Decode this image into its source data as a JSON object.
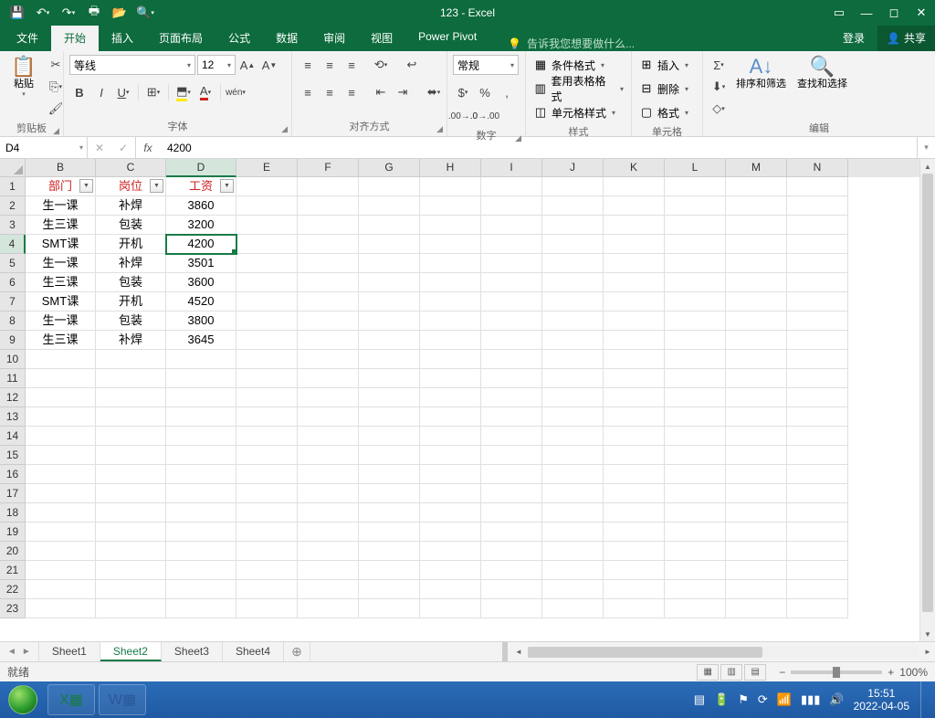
{
  "window_title": "123 - Excel",
  "qat": {
    "tips": [
      "save",
      "undo",
      "redo",
      "quick-print",
      "open",
      "print-preview"
    ]
  },
  "tabs": {
    "file": "文件",
    "list": [
      "开始",
      "插入",
      "页面布局",
      "公式",
      "数据",
      "审阅",
      "视图",
      "Power Pivot"
    ],
    "active": "开始",
    "tellme_placeholder": "告诉我您想要做什么...",
    "login": "登录",
    "share": "共享"
  },
  "ribbon": {
    "clipboard": {
      "paste": "粘贴",
      "group": "剪贴板"
    },
    "font": {
      "name": "等线",
      "size": "12",
      "group": "字体"
    },
    "align": {
      "group": "对齐方式"
    },
    "number": {
      "format": "常规",
      "group": "数字"
    },
    "styles": {
      "cond": "条件格式",
      "table": "套用表格格式",
      "cell": "单元格样式",
      "group": "样式"
    },
    "cells": {
      "insert": "插入",
      "delete": "删除",
      "format": "格式",
      "group": "单元格"
    },
    "editing": {
      "sort": "排序和筛选",
      "find": "查找和选择",
      "group": "编辑"
    }
  },
  "namebox": "D4",
  "formula": "4200",
  "columns": [
    "B",
    "C",
    "D",
    "E",
    "F",
    "G",
    "H",
    "I",
    "J",
    "K",
    "L",
    "M",
    "N"
  ],
  "active_col": "D",
  "active_row": 4,
  "row_count": 23,
  "header_row": {
    "b": "部门",
    "c": "岗位",
    "d": "工资"
  },
  "data_rows": [
    {
      "b": "生一课",
      "c": "补焊",
      "d": "3860"
    },
    {
      "b": "生三课",
      "c": "包装",
      "d": "3200"
    },
    {
      "b": "SMT课",
      "c": "开机",
      "d": "4200"
    },
    {
      "b": "生一课",
      "c": "补焊",
      "d": "3501"
    },
    {
      "b": "生三课",
      "c": "包装",
      "d": "3600"
    },
    {
      "b": "SMT课",
      "c": "开机",
      "d": "4520"
    },
    {
      "b": "生一课",
      "c": "包装",
      "d": "3800"
    },
    {
      "b": "生三课",
      "c": "补焊",
      "d": "3645"
    }
  ],
  "sheets": {
    "list": [
      "Sheet1",
      "Sheet2",
      "Sheet3",
      "Sheet4"
    ],
    "active": "Sheet2"
  },
  "status": {
    "ready": "就绪",
    "zoom": "100%"
  },
  "taskbar": {
    "time": "15:51",
    "date": "2022-04-05"
  },
  "colwidths": {
    "B": 77,
    "C": 77,
    "D": 77,
    "other": 67
  }
}
